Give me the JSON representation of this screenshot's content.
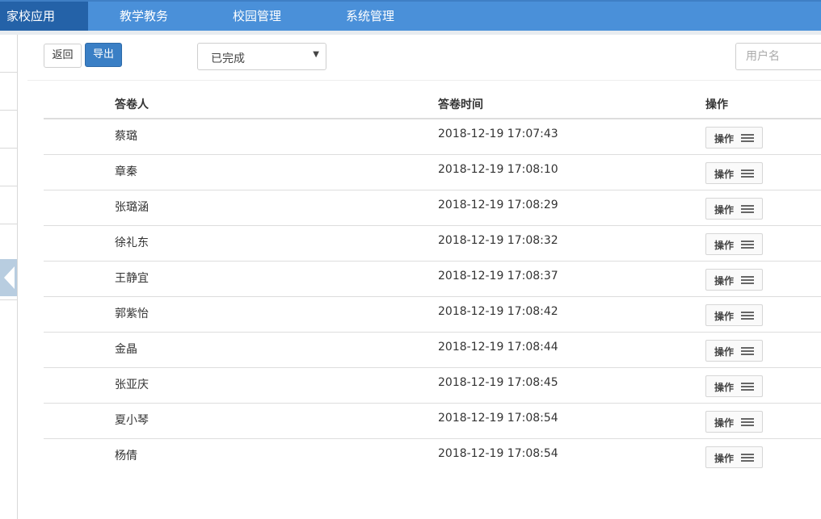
{
  "topnav": {
    "tabs": [
      {
        "label": "家校应用",
        "active": true
      },
      {
        "label": "教学教务"
      },
      {
        "label": "校园管理"
      },
      {
        "label": "系统管理"
      }
    ]
  },
  "toolbar": {
    "back_label": "返回",
    "export_label": "导出",
    "status_select": {
      "value": "已完成",
      "caret": "▼"
    },
    "search": {
      "placeholder": "用户名",
      "value": ""
    }
  },
  "table": {
    "headers": {
      "respondent": "答卷人",
      "time": "答卷时间",
      "actions": "操作"
    },
    "action_label": "操作",
    "rows": [
      {
        "name": "蔡璐",
        "time": "2018-12-19 17:07:43"
      },
      {
        "name": "章秦",
        "time": "2018-12-19 17:08:10"
      },
      {
        "name": "张璐涵",
        "time": "2018-12-19 17:08:29"
      },
      {
        "name": "徐礼东",
        "time": "2018-12-19 17:08:32"
      },
      {
        "name": "王静宜",
        "time": "2018-12-19 17:08:37"
      },
      {
        "name": "郭紫怡",
        "time": "2018-12-19 17:08:42"
      },
      {
        "name": "金晶",
        "time": "2018-12-19 17:08:44"
      },
      {
        "name": "张亚庆",
        "time": "2018-12-19 17:08:45"
      },
      {
        "name": "夏小琴",
        "time": "2018-12-19 17:08:54"
      },
      {
        "name": "杨倩",
        "time": "2018-12-19 17:08:54"
      }
    ]
  },
  "colors": {
    "nav_bg": "#4a90d9",
    "nav_active": "#2462a8",
    "primary_button": "#3a7fc5"
  },
  "icons": {
    "row_action": "menu-icon",
    "sidebar_toggle": "chevron-left-icon",
    "select_caret": "caret-down-icon"
  }
}
